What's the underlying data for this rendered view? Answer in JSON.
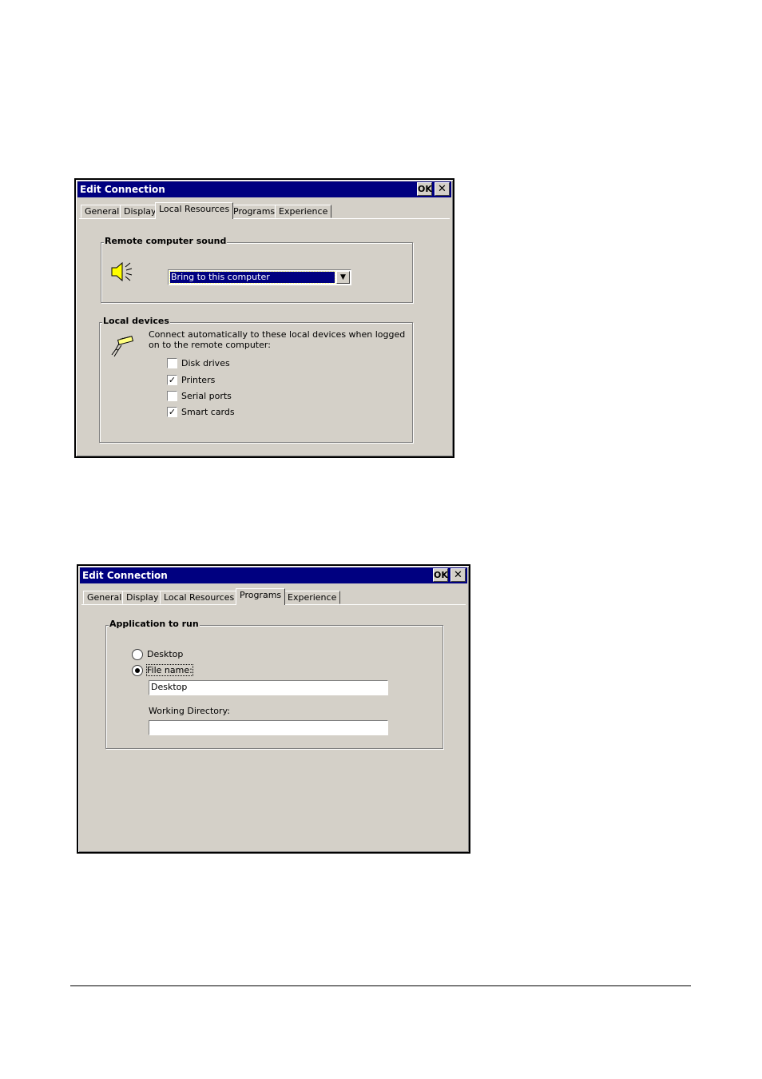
{
  "dialog1": {
    "title": "Edit Connection",
    "ok_label": "OK",
    "close_label": "✕",
    "tabs": [
      "General",
      "Display",
      "Local Resources",
      "Programs",
      "Experience"
    ],
    "active_tab": "Local Resources",
    "sound_group": {
      "legend": "Remote computer sound",
      "icon": "speaker-icon",
      "selected": "Bring to this computer"
    },
    "devices_group": {
      "legend": "Local devices",
      "icon": "plug-icon",
      "description": "Connect automatically to these local devices when logged on to the remote computer:",
      "items": [
        {
          "label": "Disk drives",
          "checked": false
        },
        {
          "label": "Printers",
          "checked": true
        },
        {
          "label": "Serial ports",
          "checked": false
        },
        {
          "label": "Smart cards",
          "checked": true
        }
      ]
    }
  },
  "dialog2": {
    "title": "Edit Connection",
    "ok_label": "OK",
    "close_label": "✕",
    "tabs": [
      "General",
      "Display",
      "Local Resources",
      "Programs",
      "Experience"
    ],
    "active_tab": "Programs",
    "app_group": {
      "legend": "Application to run",
      "radio_desktop": "Desktop",
      "radio_file": "File name:",
      "selected": "File name:",
      "file_name_value": "Desktop",
      "working_dir_label": "Working Directory:",
      "working_dir_value": ""
    }
  }
}
